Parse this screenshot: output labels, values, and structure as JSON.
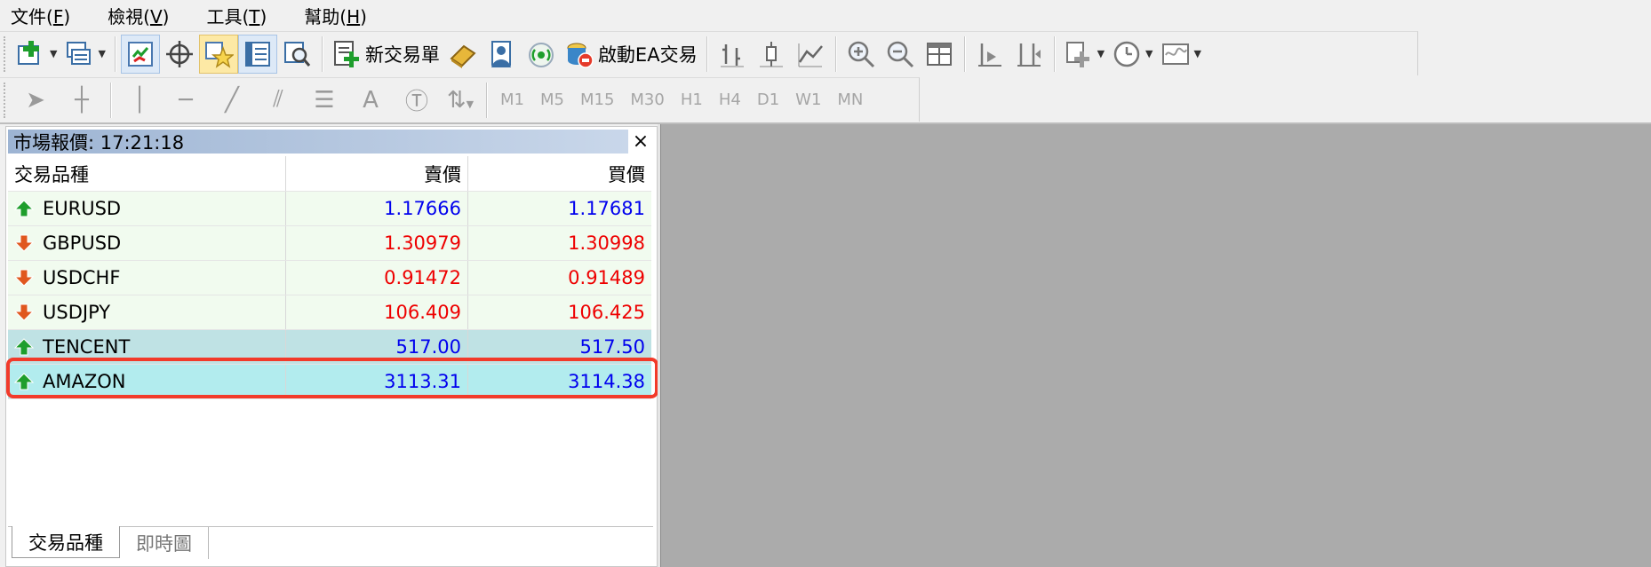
{
  "menu": [
    {
      "label": "文件(",
      "key": "F",
      "tail": ")"
    },
    {
      "label": "檢視(",
      "key": "V",
      "tail": ")"
    },
    {
      "label": "工具(",
      "key": "T",
      "tail": ")"
    },
    {
      "label": "幫助(",
      "key": "H",
      "tail": ")"
    }
  ],
  "toolbar": {
    "new_order_label": "新交易單",
    "auto_trading_label": "啟動EA交易",
    "timeframes": [
      "M1",
      "M5",
      "M15",
      "M30",
      "H1",
      "H4",
      "D1",
      "W1",
      "MN"
    ]
  },
  "market_watch": {
    "title": "市場報價: 17:21:18",
    "close": "×",
    "columns": [
      "交易品種",
      "賣價",
      "買價"
    ],
    "rows": [
      {
        "symbol": "EURUSD",
        "bid": "1.17666",
        "ask": "1.17681",
        "direction": "up"
      },
      {
        "symbol": "GBPUSD",
        "bid": "1.30979",
        "ask": "1.30998",
        "direction": "down"
      },
      {
        "symbol": "USDCHF",
        "bid": "0.91472",
        "ask": "0.91489",
        "direction": "down"
      },
      {
        "symbol": "USDJPY",
        "bid": "106.409",
        "ask": "106.425",
        "direction": "down"
      },
      {
        "symbol": "TENCENT",
        "bid": "517.00",
        "ask": "517.50",
        "direction": "up"
      },
      {
        "symbol": "AMAZON",
        "bid": "3113.31",
        "ask": "3114.38",
        "direction": "up"
      }
    ],
    "tabs": [
      "交易品種",
      "即時圖"
    ]
  },
  "colors": {
    "up": "#0000ee",
    "down": "#ee0000",
    "highlight": "#f23a2a",
    "chart_bg": "#ababab"
  }
}
